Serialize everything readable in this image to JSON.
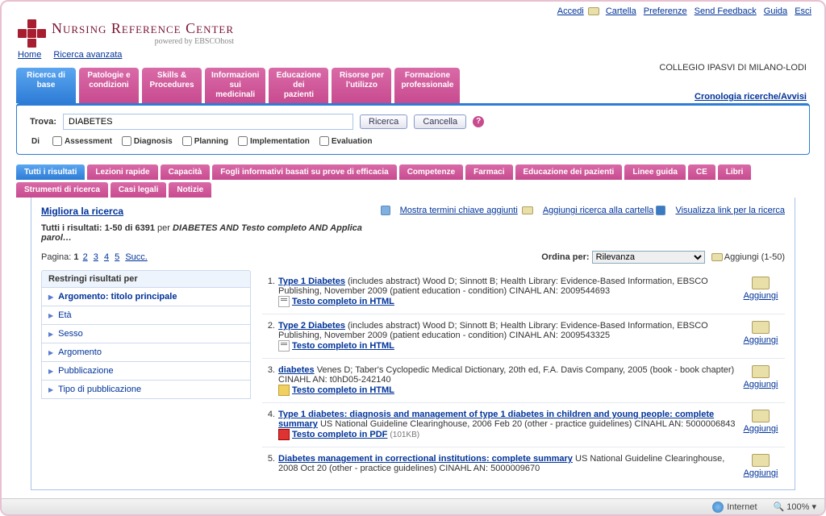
{
  "top_links": {
    "accedi": "Accedi",
    "cartella": "Cartella",
    "preferenze": "Preferenze",
    "feedback": "Send Feedback",
    "guida": "Guida",
    "esci": "Esci"
  },
  "logo": {
    "line1": "Nursing Reference Center",
    "line2": "powered by EBSCOhost"
  },
  "institution": "COLLEGIO IPASVI DI MILANO-LODI",
  "nav1": {
    "home": "Home",
    "adv": "Ricerca avanzata"
  },
  "tabs": [
    {
      "label": "Ricerca di\nbase",
      "active": true
    },
    {
      "label": "Patologie e\ncondizioni"
    },
    {
      "label": "Skills &\nProcedures"
    },
    {
      "label": "Informazioni\nsui\nmedicinali"
    },
    {
      "label": "Educazione\ndei\npazienti"
    },
    {
      "label": "Risorse per\nl'utilizzo"
    },
    {
      "label": "Formazione\nprofessionale"
    }
  ],
  "cron_link": "Cronologia ricerche/Avvisi",
  "search": {
    "label": "Trova:",
    "value": "DIABETES",
    "btn_search": "Ricerca",
    "btn_clear": "Cancella"
  },
  "limiters": {
    "prefix": "Di",
    "items": [
      "Assessment",
      "Diagnosis",
      "Planning",
      "Implementation",
      "Evaluation"
    ]
  },
  "subtabs_row1": [
    "Tutti i risultati",
    "Lezioni rapide",
    "Capacità",
    "Fogli informativi basati su prove di efficacia",
    "Competenze",
    "Farmaci",
    "Educazione dei pazienti",
    "Linee guida",
    "CE",
    "Libri"
  ],
  "subtabs_row2": [
    "Strumenti di ricerca",
    "Casi legali",
    "Notizie"
  ],
  "actions": {
    "mostra": "Mostra termini chiave aggiunti",
    "aggiungi_ric": "Aggiungi ricerca alla cartella",
    "visualizza": "Visualizza link per la ricerca"
  },
  "refine": "Migliora la ricerca",
  "summary": {
    "prefix": "Tutti i risultati: ",
    "range": "1-50 di 6391",
    "mid": " per ",
    "query": "DIABETES AND Testo completo AND Applica",
    "tail": "parol…"
  },
  "paging": {
    "label": "Pagina: ",
    "current": "1",
    "pages": [
      "2",
      "3",
      "4",
      "5"
    ],
    "next": "Succ."
  },
  "sort": {
    "label": "Ordina per:",
    "value": "Rilevanza",
    "add_range": "Aggiungi (1-50)"
  },
  "facets": {
    "header": "Restringi risultati per",
    "items": [
      "Argomento: titolo principale",
      "Età",
      "Sesso",
      "Argomento",
      "Pubblicazione",
      "Tipo di pubblicazione"
    ]
  },
  "results": [
    {
      "n": "1.",
      "title": "Type 1 Diabetes",
      "meta": "(includes abstract) Wood D; Sinnott B; Health Library: Evidence-Based Information, EBSCO Publishing, November 2009 (patient education - condition) CINAHL AN: 2009544693",
      "full": "Testo completo in HTML",
      "icon": "html"
    },
    {
      "n": "2.",
      "title": "Type 2 Diabetes",
      "meta": "(includes abstract) Wood D; Sinnott B; Health Library: Evidence-Based Information, EBSCO Publishing, November 2009 (patient education - condition) CINAHL AN: 2009543325",
      "full": "Testo completo in HTML",
      "icon": "html"
    },
    {
      "n": "3.",
      "title": "diabetes",
      "meta": "Venes D; Taber's Cyclopedic Medical Dictionary, 20th ed, F.A. Davis Company, 2005 (book - book chapter) CINAHL AN: t0hD05-242140",
      "full": "Testo completo in HTML",
      "icon": "book"
    },
    {
      "n": "4.",
      "title": "Type 1 diabetes: diagnosis and management of type 1 diabetes in children and young people: complete summary",
      "meta": "US National Guideline Clearinghouse, 2006 Feb 20 (other - practice guidelines) CINAHL AN: 5000006843",
      "full": "Testo completo in PDF",
      "size": "(101KB)",
      "icon": "pdf"
    },
    {
      "n": "5.",
      "title": "Diabetes management in correctional institutions: complete summary",
      "meta": "US National Guideline Clearinghouse, 2008 Oct 20 (other - practice guidelines) CINAHL AN: 5000009670",
      "full": "",
      "icon": ""
    }
  ],
  "add_label": "Aggiungi",
  "status": {
    "zone": "Internet",
    "zoom": "100%"
  }
}
